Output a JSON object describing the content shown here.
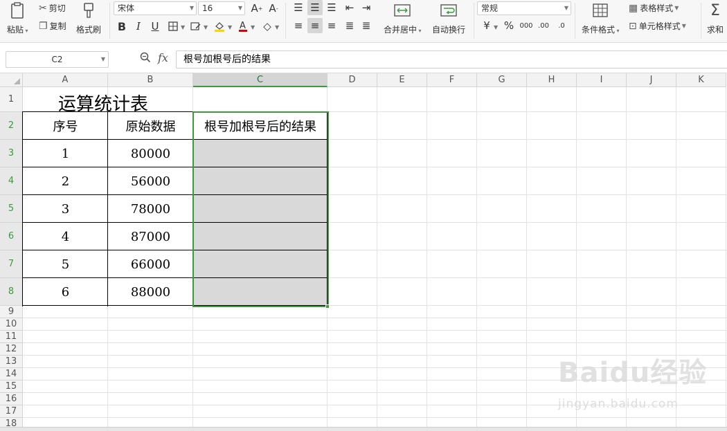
{
  "ribbon": {
    "paste_label": "粘贴",
    "cut_label": "剪切",
    "copy_label": "复制",
    "format_painter_label": "格式刷",
    "font_name": "宋体",
    "font_size": "16",
    "merge_center_label": "合并居中",
    "wrap_text_label": "自动换行",
    "number_format": "常规",
    "conditional_format_label": "条件格式",
    "table_style_label": "表格样式",
    "cell_style_label": "单元格样式",
    "sum_label": "求和",
    "accent_color": "#3c9a3c",
    "font_color_swatch": "#e00000",
    "fill_color_swatch": "#ffd200"
  },
  "formula_bar": {
    "cell_ref": "C2",
    "fx_label": "fx",
    "content": "根号加根号后的结果"
  },
  "sheet": {
    "columns": [
      "A",
      "B",
      "C",
      "D",
      "E",
      "F",
      "G",
      "H",
      "I",
      "J",
      "K"
    ],
    "rows": [
      "1",
      "2",
      "3",
      "4",
      "5",
      "6",
      "7",
      "8",
      "9",
      "10",
      "11",
      "12",
      "13",
      "14",
      "15",
      "16",
      "17",
      "18"
    ],
    "selected_column": "C",
    "title": "运算统计表",
    "headers": [
      "序号",
      "原始数据",
      "根号加根号后的结果"
    ],
    "data": [
      [
        "1",
        "80000",
        ""
      ],
      [
        "2",
        "56000",
        ""
      ],
      [
        "3",
        "78000",
        ""
      ],
      [
        "4",
        "87000",
        ""
      ],
      [
        "5",
        "66000",
        ""
      ],
      [
        "6",
        "88000",
        ""
      ]
    ]
  },
  "watermark": {
    "brand": "Baidu经验",
    "url": "jingyan.baidu.com"
  }
}
